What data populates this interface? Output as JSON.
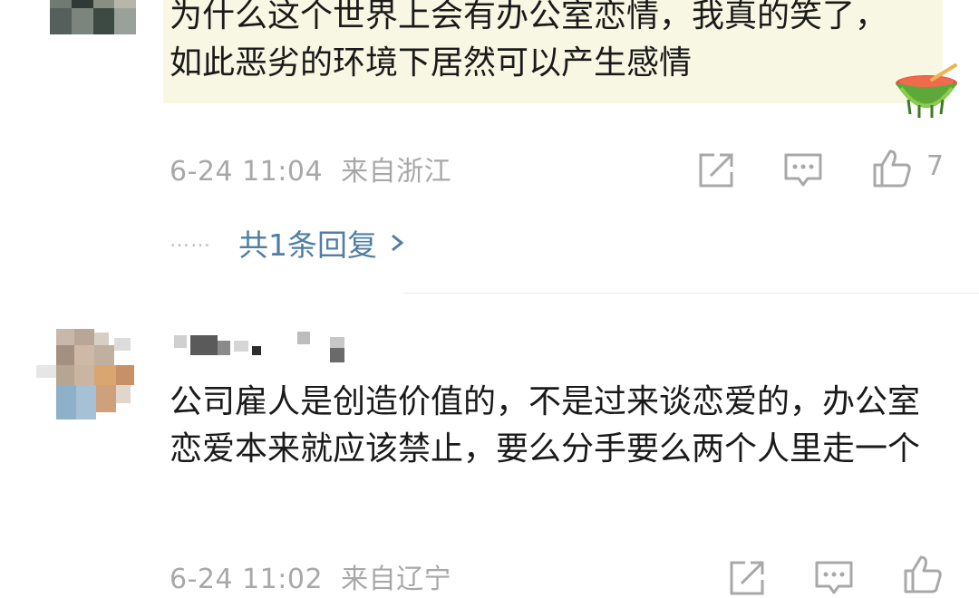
{
  "comments": [
    {
      "text": "为什么这个世界上会有办公室恋情，我真的笑了，如此恶劣的环境下居然可以产生感情",
      "date": "6-24 11:04",
      "location": "来自浙江",
      "likes": "7",
      "reply_link": "共1条回复",
      "reply_dots": "……",
      "sticker_icon": "watermelon-icon",
      "highlight_color": "#f8f7e3"
    },
    {
      "text": "公司雇人是创造价值的，不是过来谈恋爱的，办公室恋爱本来就应该禁止，要么分手要么两个人里走一个",
      "date": "6-24 11:02",
      "location": "来自辽宁"
    }
  ],
  "icons": {
    "share": "share-icon",
    "comment": "comment-icon",
    "like": "thumbs-up-icon",
    "chevron": "chevron-right-icon"
  },
  "colors": {
    "text": "#1a1a1a",
    "meta": "#a8a8a8",
    "link": "#4f7ea6",
    "divider": "#e9e9e9"
  }
}
